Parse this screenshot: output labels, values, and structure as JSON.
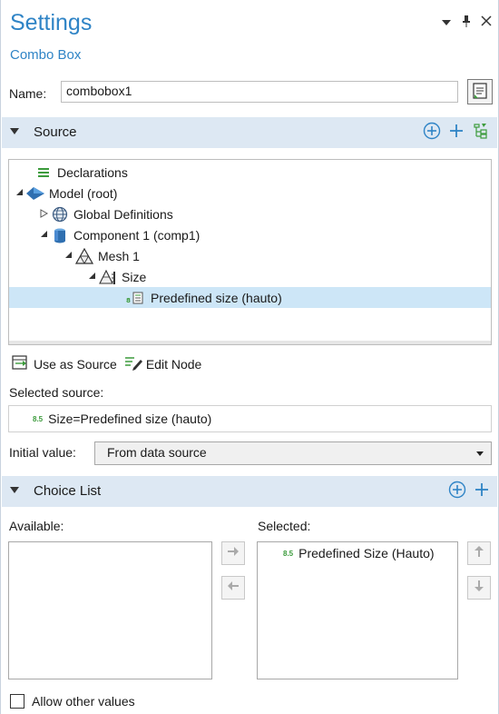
{
  "header": {
    "title": "Settings",
    "subtitle": "Combo Box",
    "window_icons": [
      "dropdown-arrow-icon",
      "pin-icon",
      "close-icon"
    ]
  },
  "name": {
    "label": "Name:",
    "value": "combobox1"
  },
  "source_section": {
    "label": "Source",
    "tree": [
      {
        "label": "Declarations",
        "icon": "declarations-icon",
        "expander": "none"
      },
      {
        "label": "Model (root)",
        "icon": "model-icon",
        "expander": "expanded"
      },
      {
        "label": "Global Definitions",
        "icon": "globe-icon",
        "expander": "collapsed"
      },
      {
        "label": "Component 1 (comp1)",
        "icon": "component-icon",
        "expander": "expanded"
      },
      {
        "label": "Mesh 1",
        "icon": "mesh-icon",
        "expander": "expanded"
      },
      {
        "label": "Size",
        "icon": "size-icon",
        "expander": "expanded"
      },
      {
        "label": "Predefined size (hauto)",
        "icon": "parameter-icon",
        "expander": "none",
        "selected": true
      }
    ],
    "use_as_source": "Use as Source",
    "edit_node": "Edit Node",
    "selected_source_label": "Selected source:",
    "selected_source_tag": "8.5",
    "selected_source_value": "Size=Predefined size (hauto)"
  },
  "initial_value": {
    "label": "Initial value:",
    "selected": "From data source"
  },
  "choice_list": {
    "label": "Choice List",
    "available_label": "Available:",
    "selected_label": "Selected:",
    "selected_items": [
      {
        "tag": "8.5",
        "label": "Predefined Size (Hauto)"
      }
    ]
  },
  "allow_other": {
    "label": "Allow other values",
    "checked": false
  },
  "colors": {
    "accent": "#2f84c6",
    "section_bg": "#dde8f3",
    "selection_bg": "#cde6f7",
    "add_icon": "#2f84c6",
    "green_icon": "#3c9b3c"
  }
}
